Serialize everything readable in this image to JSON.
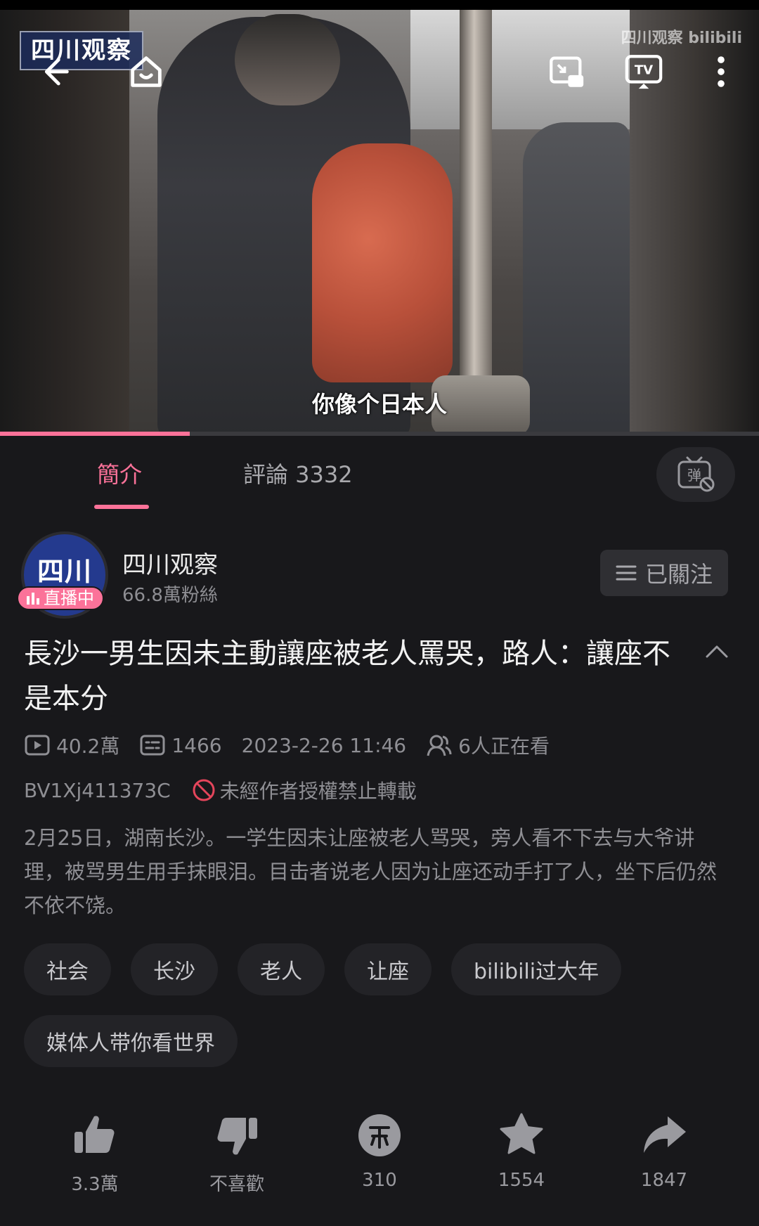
{
  "player": {
    "caption": "你像个日本人",
    "channel_logo": "四川观察",
    "watermark": "四川观察 bilibili",
    "progress": 0.25,
    "buttons": {
      "back": "back-arrow-icon",
      "home": "home-icon",
      "pip": "picture-in-picture-icon",
      "tv": "tv-cast-icon",
      "more": "more-vertical-icon"
    }
  },
  "tabs": {
    "intro": "簡介",
    "comments": "評論 3332"
  },
  "uploader": {
    "avatar_text": "四川",
    "live_badge": "直播中",
    "name": "四川观察",
    "fans": "66.8萬粉絲",
    "follow_label": "已關注"
  },
  "video": {
    "title": "長沙一男生因未主動讓座被老人罵哭，路人：讓座不是本分",
    "views": "40.2萬",
    "danmaku": "1466",
    "date": "2023-2-26 11:46",
    "watching": "6人正在看",
    "bvid": "BV1Xj411373C",
    "no_reprint": "未經作者授權禁止轉載",
    "description": "2月25日，湖南长沙。一学生因未让座被老人骂哭，旁人看不下去与大爷讲理，被骂男生用手抹眼泪。目击者说老人因为让座还动手打了人，坐下后仍然不依不饶。",
    "tags": [
      "社会",
      "长沙",
      "老人",
      "让座",
      "bilibili过大年",
      "媒体人带你看世界"
    ]
  },
  "actions": {
    "like": "3.3萬",
    "dislike": "不喜歡",
    "coin": "310",
    "favorite": "1554",
    "share": "1847"
  },
  "colors": {
    "accent": "#fb7299",
    "background": "#18181b",
    "tag_bg": "#232327"
  }
}
